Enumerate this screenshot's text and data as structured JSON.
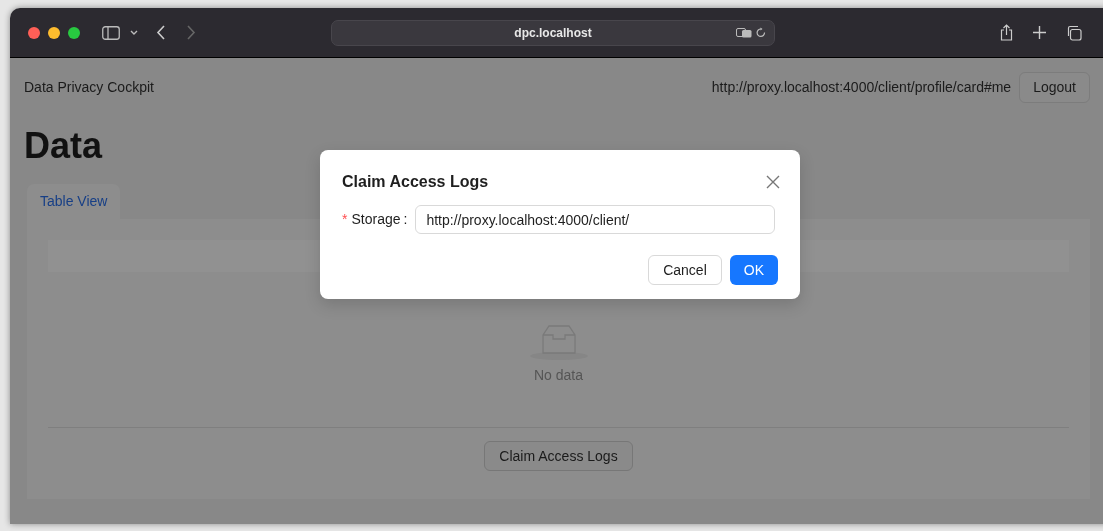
{
  "browser": {
    "address": "dpc.localhost"
  },
  "header": {
    "app_title": "Data Privacy Cockpit",
    "user_webid": "http://proxy.localhost:4000/client/profile/card#me",
    "logout_button": "Logout"
  },
  "page": {
    "heading": "Data",
    "tabs": [
      {
        "label": "Table View",
        "selected": true
      }
    ],
    "table": {
      "empty_text": "No data"
    },
    "claim_button": "Claim Access Logs"
  },
  "dialog": {
    "title": "Claim Access Logs",
    "fields": [
      {
        "required_mark": "*",
        "label": "Storage",
        "separator": ":",
        "value": "http://proxy.localhost:4000/client/"
      }
    ],
    "buttons": [
      {
        "label": "Cancel",
        "kind": "default"
      },
      {
        "label": "OK",
        "kind": "primary"
      }
    ]
  }
}
